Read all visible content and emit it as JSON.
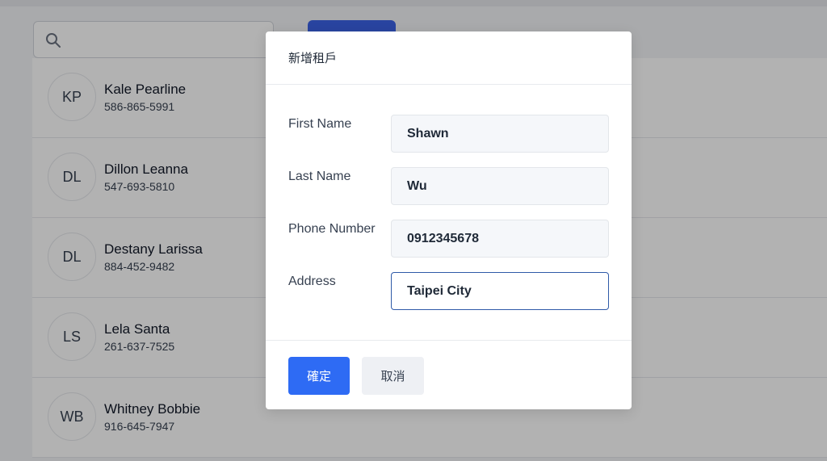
{
  "page": {
    "search": {
      "placeholder": ""
    },
    "add_button_label": "",
    "tenants": [
      {
        "initials": "KP",
        "name": "Kale Pearline",
        "phone": "586-865-5991"
      },
      {
        "initials": "DL",
        "name": "Dillon Leanna",
        "phone": "547-693-5810"
      },
      {
        "initials": "DL",
        "name": "Destany Larissa",
        "phone": "884-452-9482"
      },
      {
        "initials": "LS",
        "name": "Lela Santa",
        "phone": "261-637-7525"
      },
      {
        "initials": "WB",
        "name": "Whitney Bobbie",
        "phone": "916-645-7947"
      }
    ]
  },
  "modal": {
    "title": "新增租戶",
    "fields": [
      {
        "label": "First Name",
        "value": "Shawn"
      },
      {
        "label": "Last Name",
        "value": "Wu"
      },
      {
        "label": "Phone Number",
        "value": "0912345678"
      },
      {
        "label": "Address",
        "value": "Taipei City"
      }
    ],
    "confirm_label": "確定",
    "cancel_label": "取消"
  },
  "colors": {
    "primary": "#2e6bf4",
    "focus_border": "#2f5aa8",
    "overlay": "rgba(0,0,0,0.30)"
  },
  "icons": [
    "search-icon"
  ]
}
